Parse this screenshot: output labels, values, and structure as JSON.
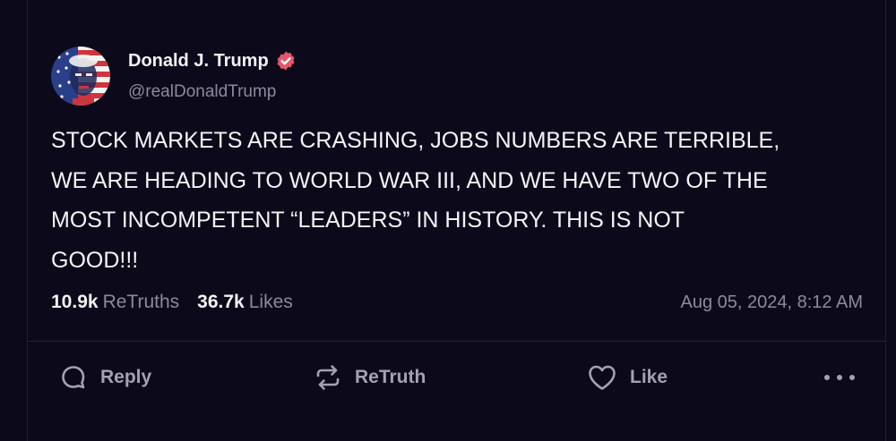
{
  "post": {
    "author": {
      "name": "Donald J. Trump",
      "handle": "@realDonaldTrump",
      "verified": true,
      "verified_color": "#e4566a"
    },
    "text": "STOCK MARKETS ARE CRASHING, JOBS NUMBERS ARE TERRIBLE,\nWE ARE HEADING TO WORLD WAR III, AND WE HAVE TWO OF THE\nMOST INCOMPETENT “LEADERS” IN HISTORY. THIS IS NOT\nGOOD!!!",
    "stats": {
      "retruths_count": "10.9k",
      "retruths_label": "ReTruths",
      "likes_count": "36.7k",
      "likes_label": "Likes"
    },
    "timestamp": "Aug 05, 2024, 8:12 AM"
  },
  "actions": {
    "reply_label": "Reply",
    "retruth_label": "ReTruth",
    "like_label": "Like",
    "more_icon": "ellipsis-icon"
  },
  "theme": {
    "background": "#0c0a1a",
    "text_primary": "#f4f4f6",
    "text_secondary": "#8b8a9c",
    "icon_color": "#a3a2b3"
  }
}
